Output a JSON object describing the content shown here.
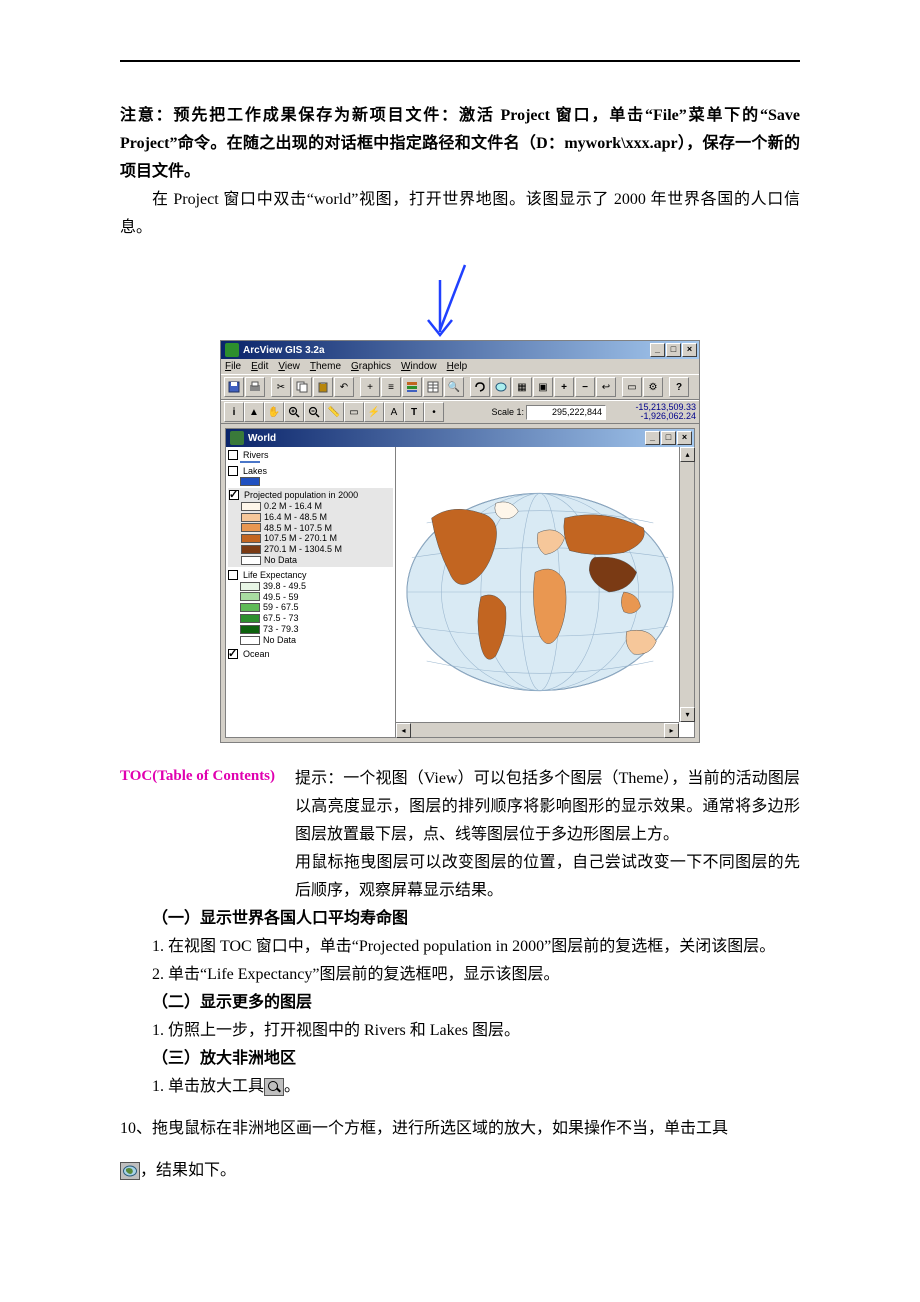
{
  "paragraphs": {
    "note_bold_prefix": "注意：预先把工作成果保存为新项目文件：激活 Project 窗口，单击“File”菜单下的“Save Project”命令。在随之出现的对话框中指定路径和文件名（D：mywork\\xxx.apr），保存一个新的项目文件。",
    "intro": "在 Project 窗口中双击“world”视图，打开世界地图。该图显示了 2000 年世界各国的人口信息。"
  },
  "hint": {
    "label": "TOC(Table of Contents)",
    "lines": [
      "提示：一个视图（View）可以包括多个图层（Theme），当前的活动图层以高亮度显示，图层的排列顺序将影响图形的显示效果。通常将多边形图层放置最下层，点、线等图层位于多边形图层上方。",
      "用鼠标拖曳图层可以改变图层的位置，自己尝试改变一下不同图层的先后顺序，观察屏幕显示结果。"
    ]
  },
  "sections": {
    "s1_heading": "（一）显示世界各国人口平均寿命图",
    "s1_step1": "1. 在视图 TOC 窗口中，单击“Projected population in 2000”图层前的复选框，关闭该图层。",
    "s1_step2": "2. 单击“Life Expectancy”图层前的复选框吧，显示该图层。",
    "s2_heading": "（二）显示更多的图层",
    "s2_step1": "1. 仿照上一步，打开视图中的 Rivers  和 Lakes 图层。",
    "s3_heading": "（三）放大非洲地区",
    "s3_step1_a": "1. 单击放大工具",
    "s3_step1_b": "。",
    "item10_a": "10、拖曳鼠标在非洲地区画一个方框，进行所选区域的放大，如果操作不当，单击工具",
    "item10_b": "，结果如下。"
  },
  "app": {
    "title": "ArcView GIS 3.2a",
    "menu": [
      "File",
      "Edit",
      "View",
      "Theme",
      "Graphics",
      "Window",
      "Help"
    ],
    "scale_label": "Scale 1:",
    "scale_value": "295,222,844",
    "coords_top": "-15,213,509.33",
    "coords_bot": "-1,926,062.24",
    "inner_title": "World",
    "layers": {
      "rivers": {
        "name": "Rivers",
        "checked": false
      },
      "lakes": {
        "name": "Lakes",
        "checked": false
      },
      "pop": {
        "name": "Projected population in 2000",
        "checked": true,
        "classes": [
          {
            "label": "0.2 M - 16.4 M",
            "color": "#fef6ea"
          },
          {
            "label": "16.4 M - 48.5 M",
            "color": "#f6c79a"
          },
          {
            "label": "48.5 M - 107.5 M",
            "color": "#e99751"
          },
          {
            "label": "107.5 M - 270.1 M",
            "color": "#c26521"
          },
          {
            "label": "270.1 M - 1304.5 M",
            "color": "#7a3a14"
          },
          {
            "label": "No Data",
            "color": "#ffffff"
          }
        ]
      },
      "life": {
        "name": "Life Expectancy",
        "checked": false,
        "classes": [
          {
            "label": "39.8 - 49.5",
            "color": "#e8f6e6"
          },
          {
            "label": "49.5 - 59",
            "color": "#a8dba1"
          },
          {
            "label": "59 - 67.5",
            "color": "#5fba57"
          },
          {
            "label": "67.5 - 73",
            "color": "#2d8f2d"
          },
          {
            "label": "73 - 79.3",
            "color": "#0d610d"
          },
          {
            "label": "No Data",
            "color": "#ffffff"
          }
        ]
      },
      "ocean": {
        "name": "Ocean",
        "checked": true
      }
    }
  }
}
